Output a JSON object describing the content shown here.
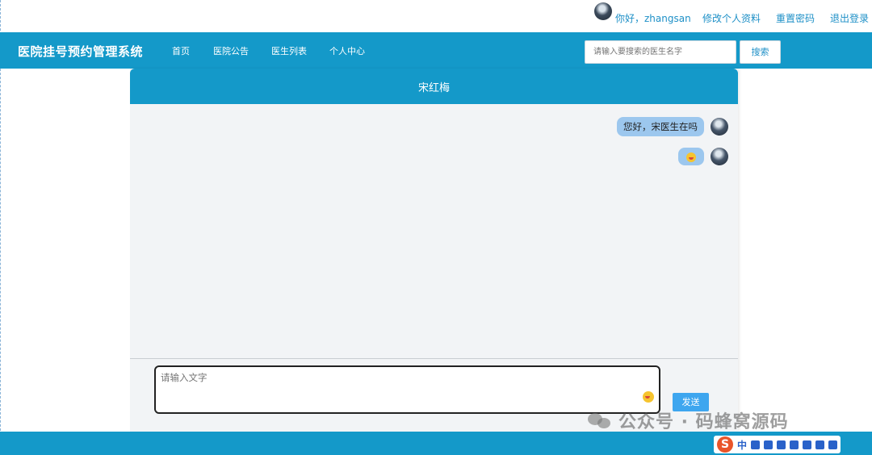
{
  "userbar": {
    "greeting": "你好，zhangsan",
    "edit_profile": "修改个人资料",
    "reset_password": "重置密码",
    "logout": "退出登录"
  },
  "navbar": {
    "brand": "医院挂号预约管理系统",
    "items": [
      "首页",
      "医院公告",
      "医生列表",
      "个人中心"
    ],
    "search_placeholder": "请输入要搜索的医生名字",
    "search_button": "搜索"
  },
  "chat": {
    "doctor_name": "宋红梅",
    "messages": [
      {
        "text": "您好，宋医生在吗"
      },
      {
        "text": "",
        "emoji": "grinning-emoji"
      }
    ],
    "input_placeholder": "请输入文字",
    "send_button": "发送"
  },
  "watermark": {
    "text": "公众号 · 码蜂窝源码"
  },
  "ime": {
    "label": "中"
  },
  "colors": {
    "primary": "#1499c9",
    "bubble": "#9cc7ee",
    "send": "#3ea6ef",
    "link": "#1e90c7"
  }
}
